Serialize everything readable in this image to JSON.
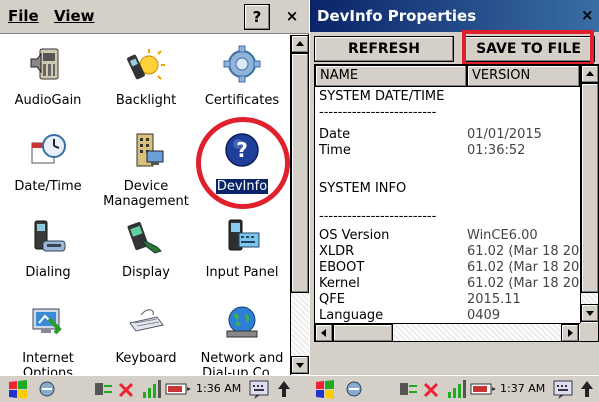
{
  "control_panel": {
    "menu": {
      "file": "File",
      "view": "View",
      "help": "?",
      "close": "×"
    },
    "items": [
      {
        "label": "AudioGain",
        "icon": "audio-gain-icon"
      },
      {
        "label": "Backlight",
        "icon": "backlight-icon"
      },
      {
        "label": "Certificates",
        "icon": "certificates-icon"
      },
      {
        "label": "Date/Time",
        "icon": "date-time-icon"
      },
      {
        "label": "Device",
        "label2": "Management",
        "icon": "device-management-icon"
      },
      {
        "label": "DevInfo",
        "icon": "devinfo-icon",
        "selected": true
      },
      {
        "label": "Dialing",
        "icon": "dialing-icon"
      },
      {
        "label": "Display",
        "icon": "display-icon"
      },
      {
        "label": "Input Panel",
        "icon": "input-panel-icon"
      },
      {
        "label": "Internet",
        "label2": "Options",
        "icon": "internet-options-icon"
      },
      {
        "label": "Keyboard",
        "icon": "keyboard-icon"
      },
      {
        "label": "Network and",
        "label2": "Dial-up Co...",
        "icon": "network-icon"
      }
    ]
  },
  "devinfo": {
    "title": "DevInfo Properties",
    "close": "×",
    "refresh": "REFRESH",
    "save_to_file": "SAVE TO FILE",
    "columns": {
      "name": "NAME",
      "version": "VERSION"
    },
    "rows": [
      {
        "name": "SYSTEM DATE/TIME",
        "value": ""
      },
      {
        "name": "-------------------------",
        "value": ""
      },
      {
        "name": "Date",
        "value": "01/01/2015"
      },
      {
        "name": "Time",
        "value": "01:36:52"
      },
      {
        "name": "",
        "value": ""
      },
      {
        "name": "SYSTEM INFO",
        "value": ""
      },
      {
        "name": "",
        "value": ""
      },
      {
        "name": "-------------------------",
        "value": ""
      },
      {
        "name": "OS Version",
        "value": "WinCE6.00"
      },
      {
        "name": "XLDR",
        "value": "61.02 (Mar 18 20"
      },
      {
        "name": "EBOOT",
        "value": "61.02 (Mar 18 20"
      },
      {
        "name": "Kernel",
        "value": "61.02 (Mar 18 20"
      },
      {
        "name": "QFE",
        "value": "2015.11"
      },
      {
        "name": "Language",
        "value": "0409"
      }
    ]
  },
  "taskbar_left": {
    "time": "1:36 AM"
  },
  "taskbar_right": {
    "time": "1:37 AM"
  },
  "colors": {
    "highlight": "#e0202c",
    "title_bar": "#0a246a",
    "chrome": "#d4d0c8"
  }
}
